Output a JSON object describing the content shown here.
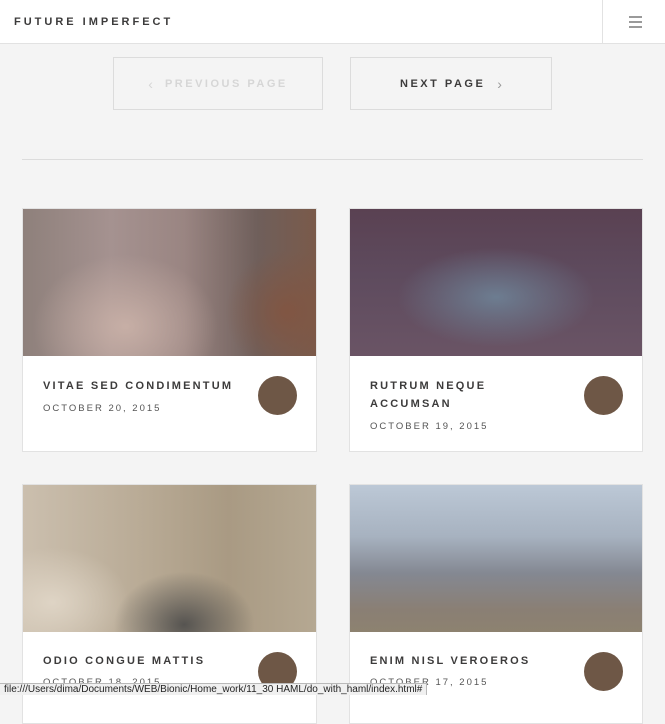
{
  "header": {
    "brand": "FUTURE IMPERFECT",
    "menu_icon": "hamburger-menu-icon"
  },
  "pagination": {
    "previous_label": "PREVIOUS PAGE",
    "previous_icon": "chevron-left-icon",
    "previous_disabled": true,
    "next_label": "NEXT PAGE",
    "next_icon": "chevron-right-icon"
  },
  "posts": [
    {
      "title": "VITAE SED CONDIMENTUM",
      "date": "OCTOBER 20, 2015"
    },
    {
      "title": "RUTRUM NEQUE ACCUMSAN",
      "date": "OCTOBER 19, 2015"
    },
    {
      "title": "ODIO CONGUE MATTIS",
      "date": "OCTOBER 18, 2015"
    },
    {
      "title": "ENIM NISL VEROEROS",
      "date": "OCTOBER 17, 2015"
    }
  ],
  "colors": {
    "text": "#3c3b3b",
    "background": "#f4f4f4",
    "disabled_text": "#d6d6d6",
    "avatar": "#6e5746"
  },
  "status_bar": {
    "url": "file:///Users/dima/Documents/WEB/Bionic/Home_work/11_30 HAML/do_with_haml/index.html#"
  }
}
